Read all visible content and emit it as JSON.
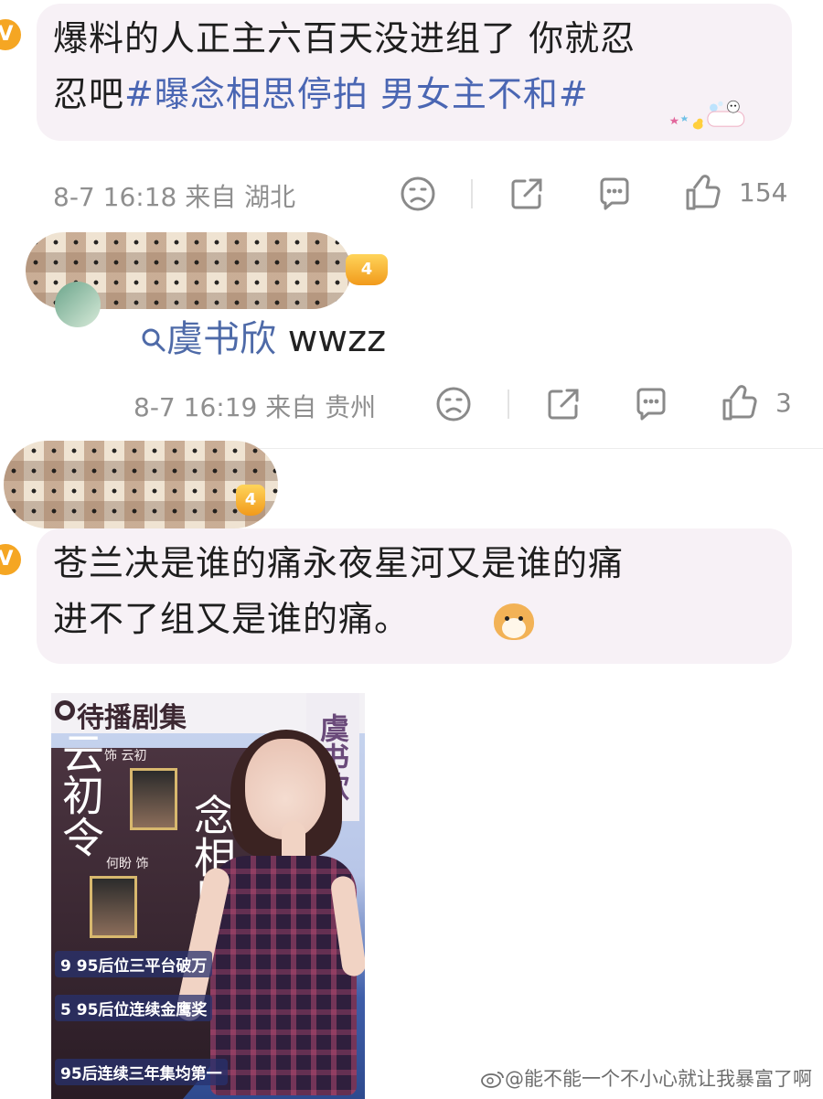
{
  "comment1": {
    "text_plain": "爆料的人正主六百天没进组了 你就忍忍吧",
    "line1": "爆料的人正主六百天没进组了 你就忍",
    "line2_prefix": "忍吧",
    "topic": "#曝念相思停拍 男女主不和#",
    "meta": "8-7 16:18 来自 湖北",
    "likes": "154"
  },
  "reply": {
    "mention_name": "虞书欣",
    "mention_suffix": "wwzz",
    "meta": "8-7 16:19 来自 贵州",
    "likes": "3"
  },
  "comment2": {
    "line1": "苍兰决是谁的痛永夜星河又是谁的痛",
    "line2": "进不了组又是谁的痛。",
    "badge_level": "4"
  },
  "poster": {
    "tag": "待播剧集",
    "name_vertical": "虞书欣",
    "title1": "云初令",
    "title2": "念相思",
    "role1": "饰 云初",
    "role2": "何盼 饰",
    "rank1": "95后位三平台破万",
    "rank2": "95后位连续金鹰奖",
    "rank3": "95后连续三年集均第一",
    "rank1_num": "9",
    "rank2_num": "5"
  },
  "watermark": "@能不能一个不小心就让我暴富了啊",
  "colors": {
    "bubble": "#f7f1f6",
    "topic": "#4a66b3",
    "meta": "#8f8f8f",
    "badge": "#f5a623"
  },
  "icons": [
    "sad-face-icon",
    "share-icon",
    "comment-icon",
    "like-icon",
    "search-icon",
    "verified-icon",
    "crown-icon"
  ]
}
